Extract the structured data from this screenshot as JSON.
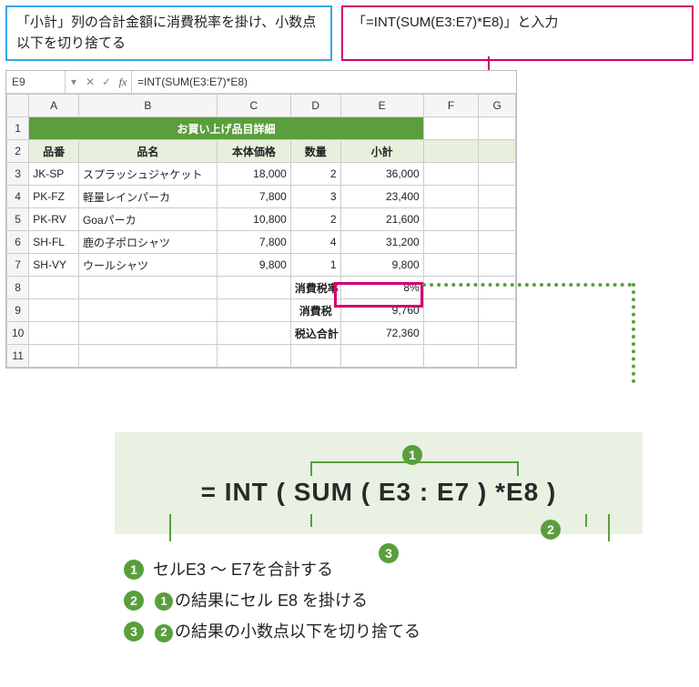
{
  "callouts": {
    "left": "「小計」列の合計金額に消費税率を掛け、小数点以下を切り捨てる",
    "right": "「=INT(SUM(E3:E7)*E8)」と入力"
  },
  "formula_bar": {
    "cell_ref": "E9",
    "dropdown_glyph": "▾",
    "cancel_glyph": "✕",
    "confirm_glyph": "✓",
    "fx_label": "fx",
    "formula": "=INT(SUM(E3:E7)*E8)"
  },
  "columns": [
    "",
    "A",
    "B",
    "C",
    "D",
    "E",
    "F",
    "G"
  ],
  "title_row": "お買い上げ品目詳細",
  "header_row": [
    "品番",
    "品名",
    "本体価格",
    "数量",
    "小計"
  ],
  "rows": [
    {
      "n": "3",
      "c": [
        "JK-SP",
        "スプラッシュジャケット",
        "18,000",
        "2",
        "36,000"
      ]
    },
    {
      "n": "4",
      "c": [
        "PK-FZ",
        "軽量レインパーカ",
        "7,800",
        "3",
        "23,400"
      ]
    },
    {
      "n": "5",
      "c": [
        "PK-RV",
        "Goaパーカ",
        "10,800",
        "2",
        "21,600"
      ]
    },
    {
      "n": "6",
      "c": [
        "SH-FL",
        "鹿の子ポロシャツ",
        "7,800",
        "4",
        "31,200"
      ]
    },
    {
      "n": "7",
      "c": [
        "SH-VY",
        "ウールシャツ",
        "9,800",
        "1",
        "9,800"
      ]
    }
  ],
  "summary": [
    {
      "n": "8",
      "label": "消費税率",
      "value": "8%"
    },
    {
      "n": "9",
      "label": "消費税",
      "value": "9,760"
    },
    {
      "n": "10",
      "label": "税込合計",
      "value": "72,360"
    }
  ],
  "row11": "11",
  "formula_display": "= INT ( SUM ( E3 : E7 ) *E8 )",
  "markers": {
    "1": "1",
    "2": "2",
    "3": "3"
  },
  "legend": {
    "l1": "セルE3 ～ E7を合計する",
    "l2_a": "の結果にセル E8 を掛ける",
    "l3_a": "の結果の小数点以下を切り捨てる"
  }
}
